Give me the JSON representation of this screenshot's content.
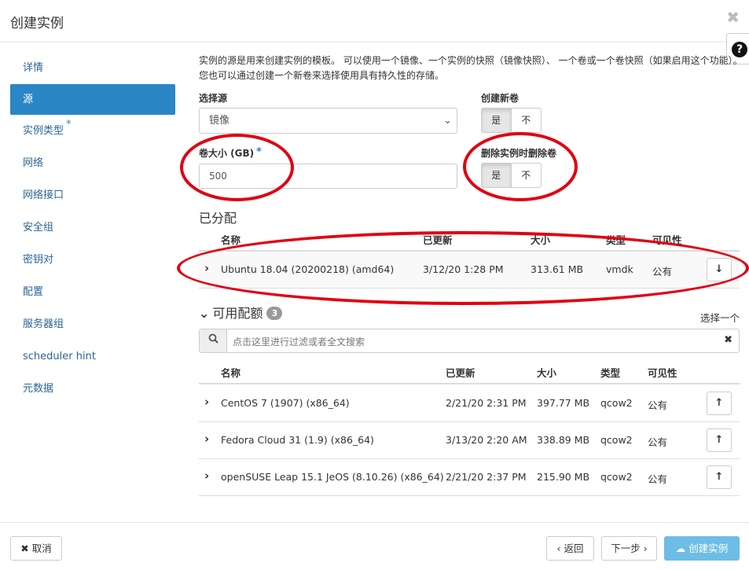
{
  "header": {
    "title": "创建实例",
    "close_symbol": "✖",
    "help_symbol": "?"
  },
  "nav": {
    "items": [
      {
        "label": "详情",
        "required": ""
      },
      {
        "label": "源",
        "required": ""
      },
      {
        "label": "实例类型",
        "required": "*"
      },
      {
        "label": "网络",
        "required": ""
      },
      {
        "label": "网络接口",
        "required": ""
      },
      {
        "label": "安全组",
        "required": ""
      },
      {
        "label": "密钥对",
        "required": ""
      },
      {
        "label": "配置",
        "required": ""
      },
      {
        "label": "服务器组",
        "required": ""
      },
      {
        "label": "scheduler hint",
        "required": ""
      },
      {
        "label": "元数据",
        "required": ""
      }
    ],
    "active_index": 1
  },
  "source": {
    "description": "实例的源是用来创建实例的模板。 可以使用一个镜像、一个实例的快照（镜像快照）、 一个卷或一个卷快照（如果启用这个功能）。 您也可以通过创建一个新卷来选择使用具有持久性的存储。",
    "select_source_label": "选择源",
    "select_source_value": "镜像",
    "create_volume_label": "创建新卷",
    "volume_size_label": "卷大小 (GB)",
    "volume_size_required": "*",
    "volume_size_value": "500",
    "delete_volume_label": "删除实例时删除卷",
    "yes": "是",
    "no": "不",
    "create_volume_selected": "是",
    "delete_volume_selected": "是"
  },
  "allocated": {
    "title": "已分配",
    "columns": [
      "名称",
      "已更新",
      "大小",
      "类型",
      "可见性"
    ],
    "rows": [
      {
        "name": "Ubuntu 18.04 (20200218) (amd64)",
        "updated": "3/12/20 1:28 PM",
        "size": "313.61 MB",
        "type": "vmdk",
        "visibility": "公有",
        "action": "↓"
      }
    ]
  },
  "available": {
    "title": "可用配额",
    "count": "3",
    "select_one": "选择一个",
    "search_placeholder": "点击这里进行过滤或者全文搜索",
    "search_icon": "🔍",
    "clear_symbol": "✖",
    "columns": [
      "名称",
      "已更新",
      "大小",
      "类型",
      "可见性"
    ],
    "rows": [
      {
        "name": "CentOS 7 (1907) (x86_64)",
        "updated": "2/21/20 2:31 PM",
        "size": "397.77 MB",
        "type": "qcow2",
        "visibility": "公有",
        "action": "↑"
      },
      {
        "name": "Fedora Cloud 31 (1.9) (x86_64)",
        "updated": "3/13/20 2:20 AM",
        "size": "338.89 MB",
        "type": "qcow2",
        "visibility": "公有",
        "action": "↑"
      },
      {
        "name": "openSUSE Leap 15.1 JeOS (8.10.26) (x86_64)",
        "updated": "2/21/20 2:37 PM",
        "size": "215.90 MB",
        "type": "qcow2",
        "visibility": "公有",
        "action": "↑"
      }
    ]
  },
  "footer": {
    "cancel": "✖ 取消",
    "back": "‹ 返回",
    "next": "下一步 ›",
    "create": "☁ 创建实例"
  },
  "colors": {
    "accent": "#2b86c5",
    "annotation_red": "#e00012",
    "primary_button": "#5fb6e4"
  }
}
